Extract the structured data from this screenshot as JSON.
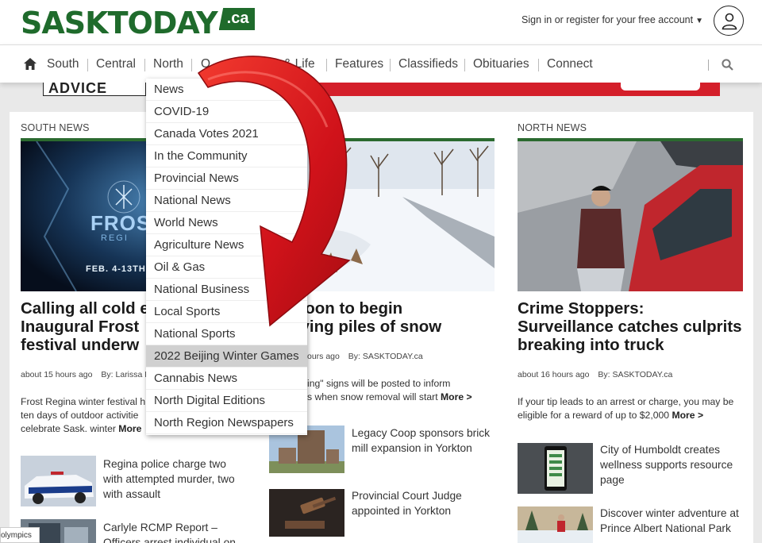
{
  "header": {
    "logo_main": "SASKTODAY",
    "logo_suffix": ".ca",
    "signin_text": "Sign in or register for your free account",
    "avatar_label": "account"
  },
  "nav": {
    "items": [
      "South",
      "Central",
      "North",
      "O",
      "& Life",
      "Features",
      "Classifieds",
      "Obituaries",
      "Connect"
    ]
  },
  "ad": {
    "text": "ADVICE"
  },
  "columns": {
    "south": {
      "heading": "SOUTH NEWS",
      "photo_text": "FROS",
      "photo_subtext": "REGI",
      "photo_dates": "FEB. 4-13TH",
      "headline": "Calling all cold e... Inaugural Frost ... festival underw...",
      "headline_lines": [
        "Calling all cold e",
        "Inaugural Frost",
        "festival underw"
      ],
      "meta_time": "about 15 hours ago",
      "meta_by": "By: Larissa Ki",
      "summary_lines": [
        "Frost Regina winter festival h",
        "ten days of outdoor activitie",
        "celebrate Sask. winter"
      ],
      "more": "More",
      "items": [
        {
          "title": "Regina police charge two with attempted murder, two with assault",
          "title_lines": [
            "Regina police charge two",
            "with attempted murder, two",
            "with assault"
          ]
        },
        {
          "title": "Carlyle RCMP Report – Officers arrest individual on",
          "title_lines": [
            "Carlyle RCMP Report –",
            "Officers arrest individual on"
          ]
        }
      ]
    },
    "central": {
      "headline_lines": [
        "atoon to begin",
        "oving piles of snow"
      ],
      "meta_time": "ours ago",
      "meta_by": "By: SASKTODAY.ca",
      "summary_lines": [
        "ing\" signs will be posted to inform",
        "s when snow removal will start"
      ],
      "more": "More >",
      "items": [
        {
          "title_lines": [
            "Legacy Coop sponsors brick",
            "mill expansion in Yorkton"
          ]
        },
        {
          "title_lines": [
            "Provincial Court Judge",
            "appointed in Yorkton"
          ]
        }
      ]
    },
    "north": {
      "heading": "NORTH NEWS",
      "headline_lines": [
        "Crime Stoppers:",
        "Surveillance catches culprits",
        "breaking into truck"
      ],
      "meta_time": "about 16 hours ago",
      "meta_by": "By: SASKTODAY.ca",
      "summary_lines": [
        "If your tip leads to an arrest or charge, you may be",
        "eligible for a reward of up to $2,000"
      ],
      "more": "More >",
      "items": [
        {
          "title_lines": [
            "City of Humboldt creates",
            "wellness supports resource",
            "page"
          ]
        },
        {
          "title_lines": [
            "Discover winter adventure at",
            "Prince Albert National Park"
          ]
        }
      ]
    }
  },
  "dropdown": {
    "items": [
      "News",
      "COVID-19",
      "Canada Votes 2021",
      "In the Community",
      "Provincial News",
      "National News",
      "World News",
      "Agriculture News",
      "Oil & Gas",
      "National Business",
      "Local Sports",
      "National Sports",
      "2022 Beijing Winter Games",
      "Cannabis News",
      "North Digital Editions",
      "North Region Newspapers"
    ],
    "active": "2022 Beijing Winter Games"
  },
  "footer_tag": "olympics",
  "colors": {
    "brand_green": "#1f6b2c",
    "arrow_red": "#d4161c",
    "ad_red": "#d41f2a"
  }
}
